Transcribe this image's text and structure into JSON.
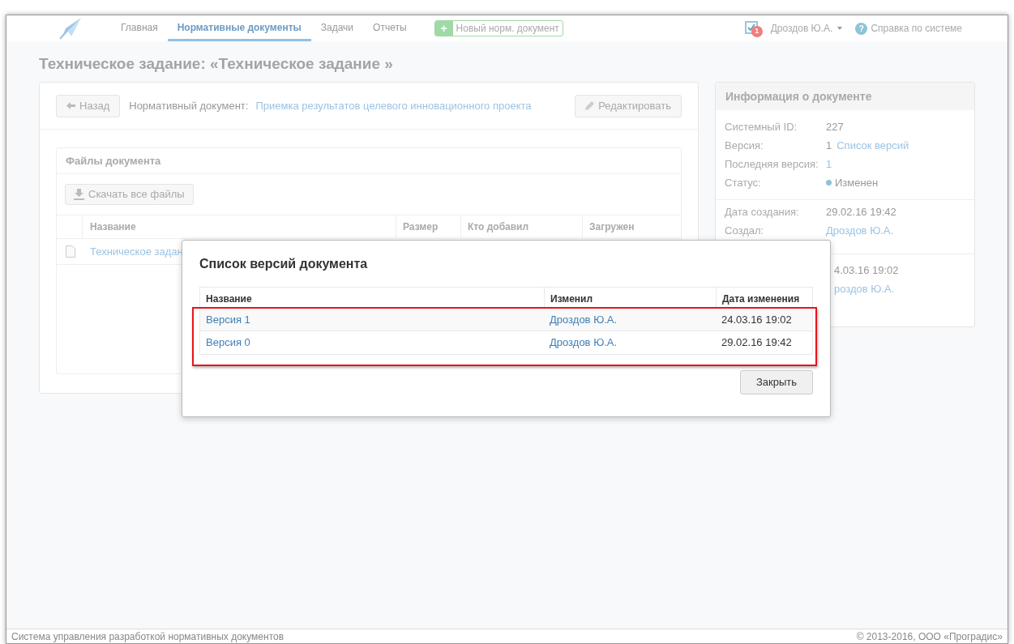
{
  "nav": {
    "items": [
      {
        "label": "Главная",
        "selected": false
      },
      {
        "label": "Нормативные документы",
        "selected": true
      },
      {
        "label": "Задачи",
        "selected": false
      },
      {
        "label": "Отчеты",
        "selected": false
      }
    ],
    "new_button": {
      "icon": "+",
      "label": "Новый норм. документ"
    },
    "user": {
      "name": "Дроздов Ю.А.",
      "badge": "1"
    },
    "help": {
      "icon": "?",
      "label": "Справка по системе"
    }
  },
  "page_title": "Техническое задание: «Техническое задание »",
  "toolbar": {
    "back": "Назад",
    "doc_label": "Нормативный документ:",
    "doc_link": "Приемка результатов целевого инновационного проекта",
    "edit": "Редактировать"
  },
  "files": {
    "title": "Файлы документа",
    "download": "Скачать все файлы",
    "columns": [
      "Название",
      "Размер",
      "Кто добавил",
      "Загружен"
    ],
    "rows": [
      {
        "name": "Техническое задан"
      }
    ]
  },
  "info": {
    "title": "Информация о документе",
    "rows": [
      {
        "label": "Системный ID:",
        "parts": [
          {
            "kind": "plain",
            "text": "227"
          }
        ]
      },
      {
        "label": "Версия:",
        "parts": [
          {
            "kind": "plain",
            "text": "1"
          },
          {
            "kind": "link",
            "text": "Список версий"
          }
        ]
      },
      {
        "label": "Последняя версия:",
        "parts": [
          {
            "kind": "link",
            "text": "1"
          }
        ]
      },
      {
        "label": "Статус:",
        "parts": [
          {
            "kind": "status",
            "text": "Изменен",
            "color": "#8ec3d8"
          }
        ]
      }
    ],
    "created": [
      {
        "label": "Дата создания:",
        "parts": [
          {
            "kind": "plain",
            "text": "29.02.16 19:42"
          }
        ]
      },
      {
        "label": "Создал:",
        "parts": [
          {
            "kind": "link",
            "text": "Дроздов Ю.А."
          }
        ]
      }
    ],
    "modified_partial": [
      {
        "kind": "plain",
        "text": "4.03.16 19:02"
      },
      {
        "kind": "link",
        "text": "роздов Ю.А."
      }
    ]
  },
  "modal": {
    "title": "Список версий документа",
    "columns": [
      "Название",
      "Изменил",
      "Дата изменения"
    ],
    "rows": [
      {
        "name": "Версия 1",
        "author": "Дроздов Ю.А.",
        "date": "24.03.16 19:02"
      },
      {
        "name": "Версия 0",
        "author": "Дроздов Ю.А.",
        "date": "29.02.16 19:42"
      }
    ],
    "close": "Закрыть"
  },
  "footer": {
    "left": "Система управления разработкой нормативных документов",
    "right": "© 2013-2016, ООО «Проградис»"
  }
}
